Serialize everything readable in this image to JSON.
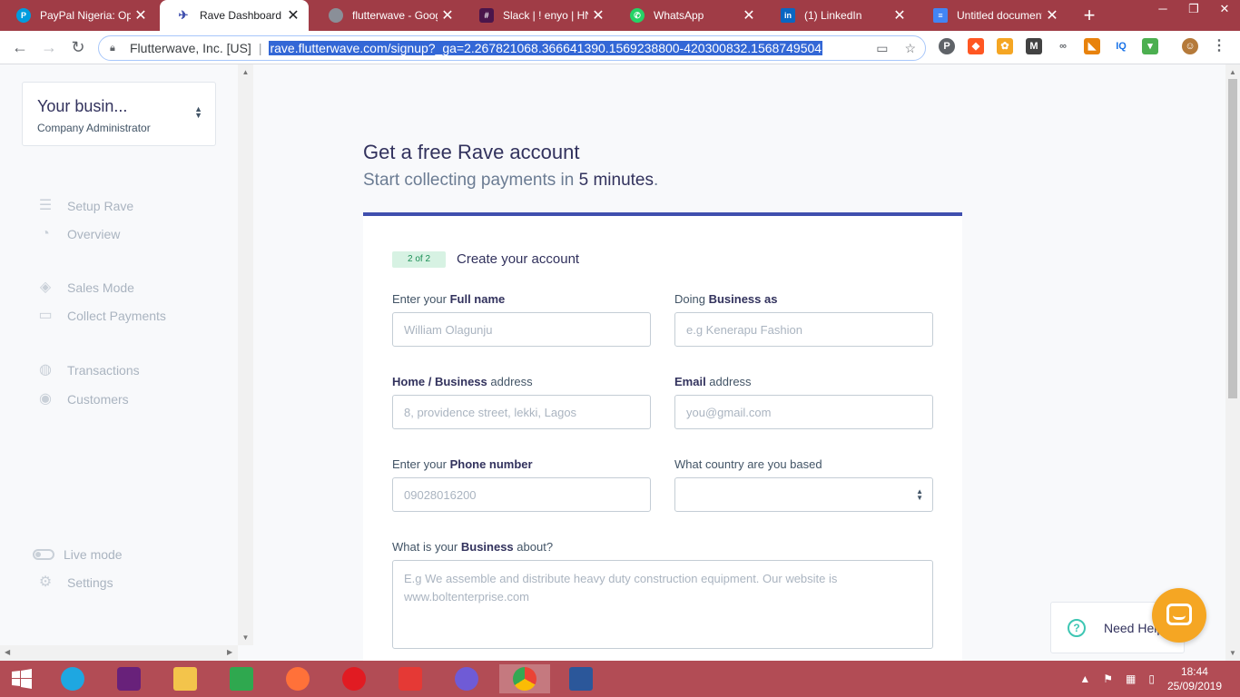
{
  "browser": {
    "tabs": [
      {
        "label": "PayPal Nigeria: Ope",
        "icon": "paypal-icon",
        "color": "#009cde",
        "glyph": "P"
      },
      {
        "label": "Rave Dashboard",
        "icon": "rave-icon",
        "color": "#3f4fae",
        "glyph": "✈"
      },
      {
        "label": "flutterwave - Googl",
        "icon": "globe-icon",
        "color": "#8a8f98",
        "glyph": ""
      },
      {
        "label": "Slack | ! enyo | HNG",
        "icon": "slack-icon",
        "color": "#4a154b",
        "glyph": "#"
      },
      {
        "label": "WhatsApp",
        "icon": "whatsapp-icon",
        "color": "#25d366",
        "glyph": "✆"
      },
      {
        "label": "(1) LinkedIn",
        "icon": "linkedin-icon",
        "color": "#0a66c2",
        "glyph": "in"
      },
      {
        "label": "Untitled document",
        "icon": "google-docs-icon",
        "color": "#4285f4",
        "glyph": "≡"
      }
    ],
    "new_tab": "+",
    "site_name": "Flutterwave, Inc. [US]",
    "url": "rave.flutterwave.com/signup?_ga=2.267821068.366641390.1569238800-420300832.1568749504"
  },
  "sidebar": {
    "business_name": "Your busin...",
    "business_role": "Company Administrator",
    "items": [
      {
        "label": "Setup Rave",
        "icon": "sliders-icon",
        "glyph": "☰"
      },
      {
        "label": "Overview",
        "icon": "gauge-icon",
        "glyph": "◔"
      },
      {
        "label": "Sales Mode",
        "icon": "tag-icon",
        "glyph": "◈"
      },
      {
        "label": "Collect Payments",
        "icon": "cash-icon",
        "glyph": "▭"
      },
      {
        "label": "Transactions",
        "icon": "transactions-icon",
        "glyph": "◍"
      },
      {
        "label": "Customers",
        "icon": "customers-icon",
        "glyph": "◉"
      }
    ],
    "live_mode": "Live mode",
    "settings": "Settings"
  },
  "main": {
    "title": "Get a free Rave account",
    "subtitle_prefix": "Start collecting payments in",
    "subtitle_emphasis": "5 minutes",
    "subtitle_suffix": ".",
    "step_badge": "2 of 2",
    "card_title": "Create your account",
    "fields": {
      "full_name": {
        "label_pre": "Enter your ",
        "label_bold": "Full name",
        "label_post": "",
        "placeholder": "William Olagunju"
      },
      "business_as": {
        "label_pre": "Doing ",
        "label_bold": "Business as",
        "label_post": "",
        "placeholder": "e.g Kenerapu Fashion"
      },
      "address": {
        "label_pre": "",
        "label_bold": "Home / Business",
        "label_post": " address",
        "placeholder": "8, providence street, lekki, Lagos"
      },
      "email": {
        "label_pre": "",
        "label_bold": "Email",
        "label_post": " address",
        "placeholder": "you@gmail.com"
      },
      "phone": {
        "label_pre": "Enter your ",
        "label_bold": "Phone number",
        "label_post": "",
        "placeholder": "09028016200"
      },
      "country": {
        "label": "What country are you based",
        "value": ""
      },
      "about": {
        "label_pre": "What is your ",
        "label_bold": "Business",
        "label_post": " about?",
        "placeholder": "E.g We assemble and distribute heavy duty construction equipment. Our website is www.boltenterprise.com"
      }
    }
  },
  "help_widget": {
    "label": "Need Help?"
  },
  "taskbar": {
    "apps": [
      {
        "name": "start-button",
        "color": "#ffffff"
      },
      {
        "name": "internet-explorer-icon",
        "color": "#1ea7e1"
      },
      {
        "name": "visual-studio-icon",
        "color": "#68217a"
      },
      {
        "name": "file-explorer-icon",
        "color": "#f3c44b"
      },
      {
        "name": "store-icon",
        "color": "#2fa84f"
      },
      {
        "name": "firefox-icon",
        "color": "#ff7139"
      },
      {
        "name": "opera-icon",
        "color": "#e11b22"
      },
      {
        "name": "download-icon",
        "color": "#e53935"
      },
      {
        "name": "browser-icon",
        "color": "#6f5bd6"
      },
      {
        "name": "chrome-icon",
        "color": "#4caf50"
      },
      {
        "name": "word-icon",
        "color": "#2b579a"
      }
    ],
    "time": "18:44",
    "date": "25/09/2019"
  }
}
